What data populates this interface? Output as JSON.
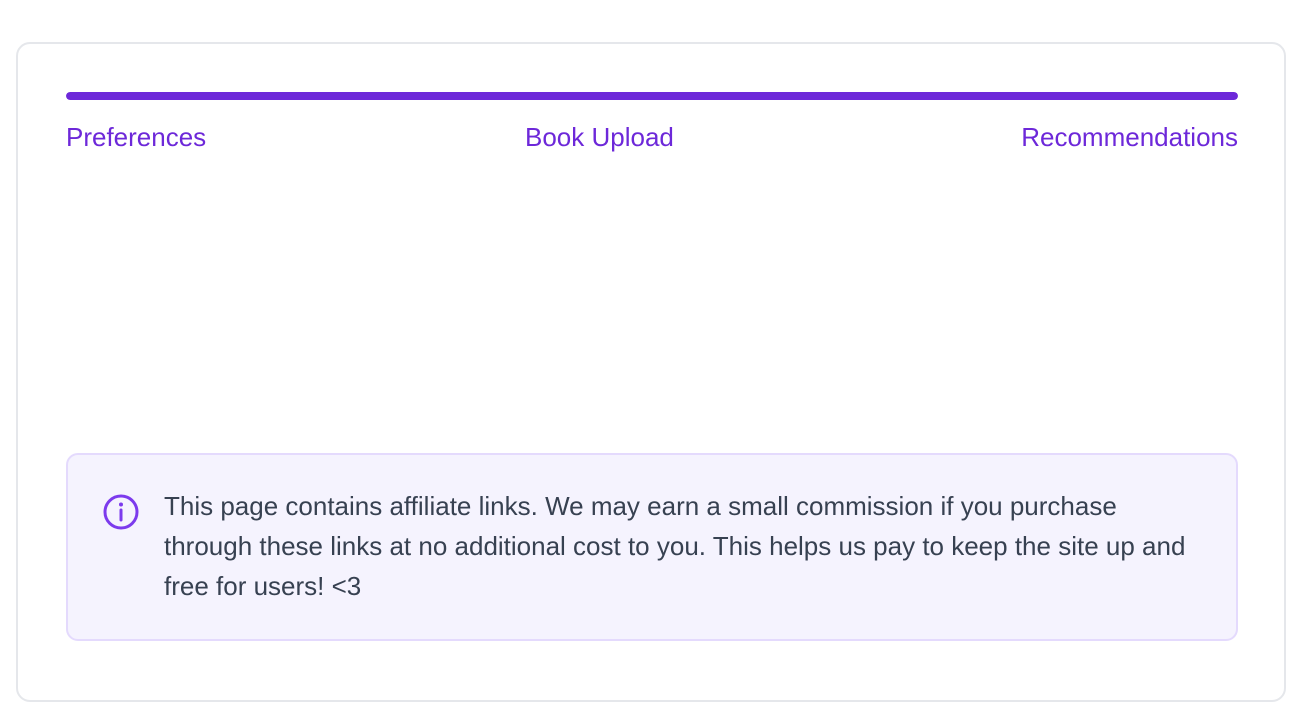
{
  "progress": {
    "value": 1.0,
    "color": "#6d28d9",
    "track_color": "#ede9fe"
  },
  "steps": [
    {
      "label": "Preferences"
    },
    {
      "label": "Book Upload"
    },
    {
      "label": "Recommendations"
    }
  ],
  "notice": {
    "icon": "info-icon",
    "text": "This page contains affiliate links. We may earn a small commission if you purchase through these links at no additional cost to you. This helps us pay to keep the site up and free for users! <3"
  }
}
